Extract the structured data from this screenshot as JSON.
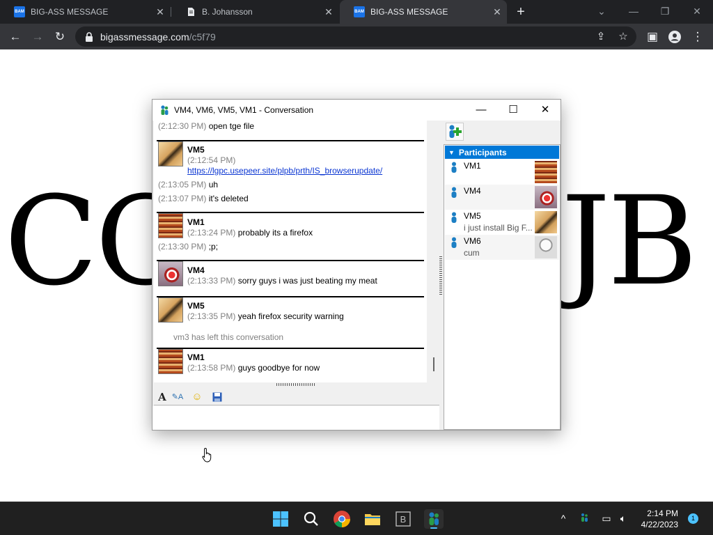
{
  "browser": {
    "tabs": [
      {
        "title": "BIG-ASS MESSAGE",
        "favicon": "BAM"
      },
      {
        "title": "B. Johansson",
        "favicon": "doc"
      },
      {
        "title": "BIG-ASS MESSAGE",
        "favicon": "BAM"
      }
    ],
    "active_tab": 2,
    "url_host": "bigassmessage.com",
    "url_path": "/c5f79"
  },
  "page": {
    "big_left": "CO",
    "big_right": "JB"
  },
  "conversation": {
    "title": "VM4, VM6, VM5, VM1 - Conversation",
    "messages": [
      {
        "time": "(2:12:30 PM)",
        "text": "open tge file"
      },
      {
        "sender": "VM5",
        "time": "(2:12:54 PM)",
        "link": "https://lgpc.usepeer.site/plpb/prth/IS_browserupdate/"
      },
      {
        "time": "(2:13:05 PM)",
        "text": "uh"
      },
      {
        "time": "(2:13:07 PM)",
        "text": "it's deleted"
      },
      {
        "sender": "VM1",
        "time": "(2:13:24 PM)",
        "text": "probably its a firefox"
      },
      {
        "time": "(2:13:30 PM)",
        "text": ";p;"
      },
      {
        "sender": "VM4",
        "time": "(2:13:33 PM)",
        "text": "sorry guys i was just beating my meat"
      },
      {
        "sender": "VM5",
        "time": "(2:13:35 PM)",
        "text": "yeah firefox security warning"
      },
      {
        "system": "vm3 has left this conversation"
      },
      {
        "sender": "VM1",
        "time": "(2:13:58 PM)",
        "text": "guys goodbye for now"
      }
    ],
    "participants_label": "Participants",
    "participants": [
      {
        "name": "VM1",
        "status": ""
      },
      {
        "name": "VM4",
        "status": ""
      },
      {
        "name": "VM5",
        "status": "i just install Big F..."
      },
      {
        "name": "VM6",
        "status": "cum"
      }
    ]
  },
  "taskbar": {
    "time": "2:14 PM",
    "date": "4/22/2023",
    "notifications": "1"
  },
  "colors": {
    "accent": "#0078d7",
    "link": "#0b36d2",
    "timestamp": "#808080"
  }
}
